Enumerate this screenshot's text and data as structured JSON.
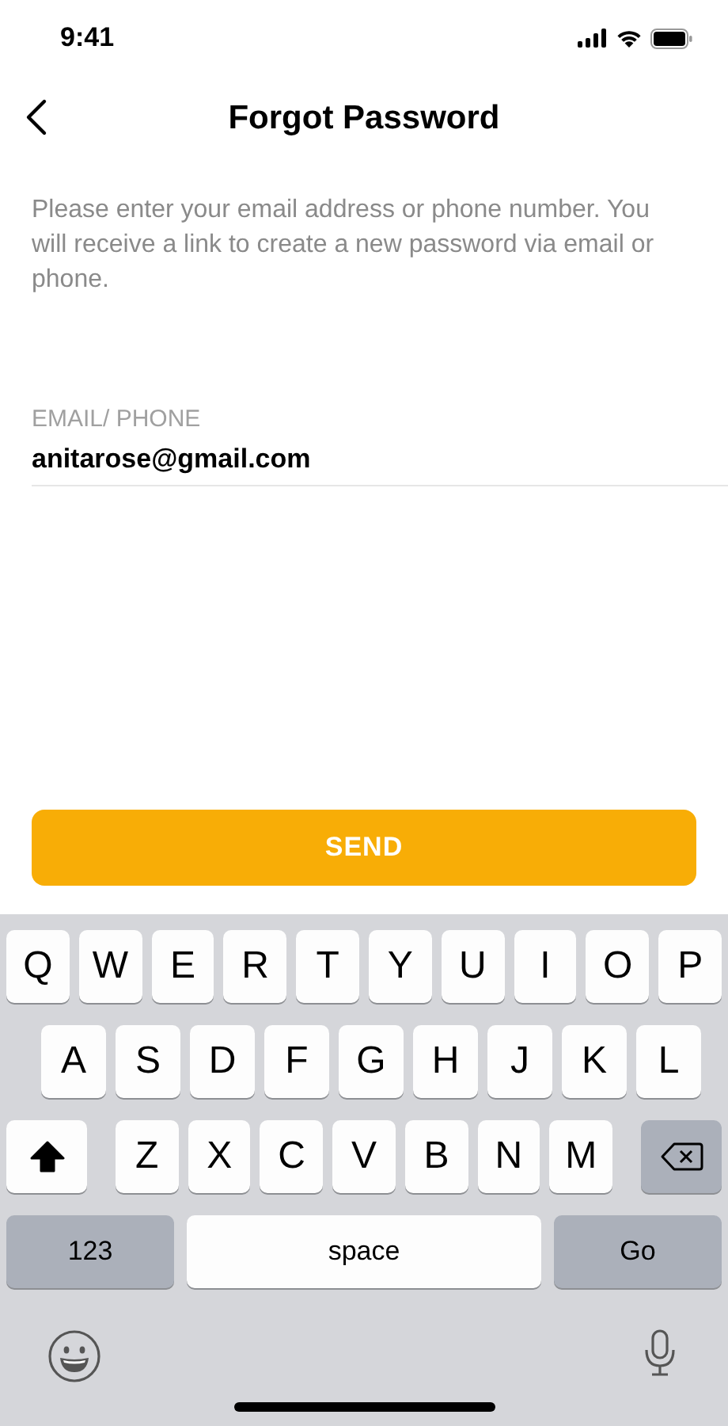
{
  "status_bar": {
    "time": "9:41"
  },
  "nav": {
    "title": "Forgot Password"
  },
  "description": "Please enter your email address or phone number. You will receive a link to create a new password via email or phone.",
  "field": {
    "label": "EMAIL/ PHONE",
    "value": "anitarose@gmail.com"
  },
  "send_button": {
    "label": "SEND"
  },
  "keyboard": {
    "shift_on": true,
    "letter_rows": [
      [
        "Q",
        "W",
        "E",
        "R",
        "T",
        "Y",
        "U",
        "I",
        "O",
        "P"
      ],
      [
        "A",
        "S",
        "D",
        "F",
        "G",
        "H",
        "J",
        "K",
        "L"
      ],
      [
        "Z",
        "X",
        "C",
        "V",
        "B",
        "N",
        "M"
      ]
    ],
    "bottom_keys": [
      {
        "kind": "numbers",
        "label": "123"
      },
      {
        "kind": "space",
        "label": "space"
      },
      {
        "kind": "return",
        "label": "Go"
      }
    ]
  }
}
